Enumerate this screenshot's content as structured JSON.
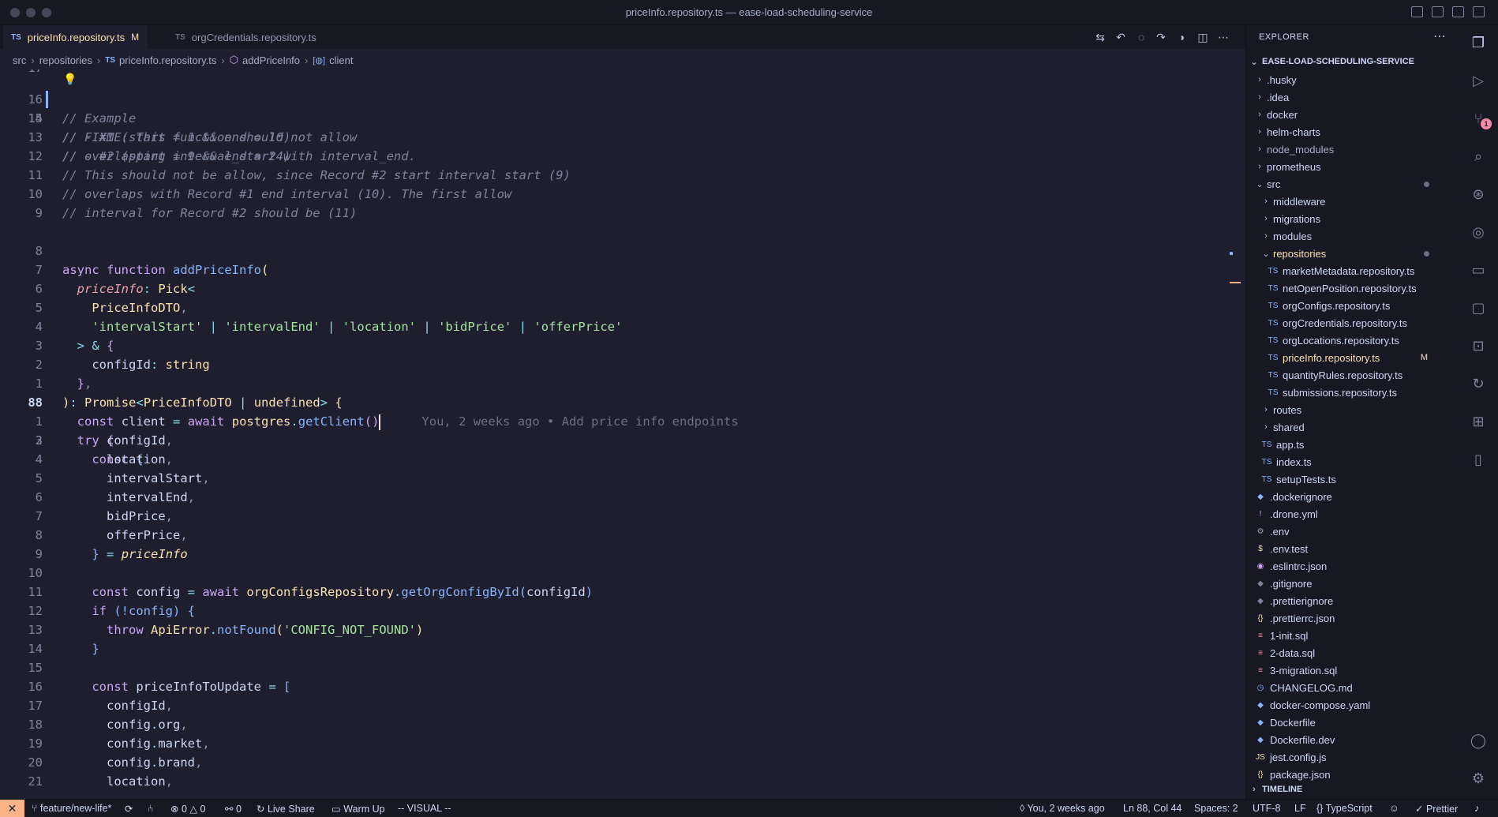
{
  "window": {
    "title": "priceInfo.repository.ts — ease-load-scheduling-service"
  },
  "tabs": [
    {
      "lang": "TS",
      "label": "priceInfo.repository.ts",
      "modified": "M"
    },
    {
      "lang": "TS",
      "label": "orgCredentials.repository.ts"
    }
  ],
  "breadcrumb": {
    "p1": "src",
    "p2": "repositories",
    "lang": "TS",
    "p3": "priceInfo.repository.ts",
    "p4": "addPriceInfo",
    "p5": "client"
  },
  "editor": {
    "top_partial_ln": "17",
    "line_numbers": [
      "16",
      "15",
      "14",
      "13",
      "12",
      "11",
      "10",
      "9",
      "8",
      "7",
      "6",
      "5",
      "4",
      "3",
      "2",
      "1",
      "88",
      "1",
      "2",
      "3",
      "4",
      "5",
      "6",
      "7",
      "8",
      "9",
      "10",
      "11",
      "12",
      "13",
      "14",
      "15",
      "16",
      "17",
      "18",
      "19",
      "20",
      "21"
    ],
    "comments": [
      "// FIXME: This function should not allow",
      "// overlapping interval_start with interval_end.",
      "// Example",
      "// - #1 (start = 1 && end = 10)",
      "// - #2 (start = 9 && end = 24)",
      "// This should not be allow, since Record #2 start interval start (9)",
      "// overlaps with Record #1 end interval (10). The first allow",
      "// interval for Record #2 should be (11)"
    ],
    "kw_async": "async",
    "kw_function": "function",
    "fn_name": "addPriceInfo",
    "paren_open": "(",
    "param": "priceInfo",
    "colon": ":",
    "pick": "Pick",
    "lt": "<",
    "dto": "PriceInfoDTO",
    "comma": ",",
    "str_intervalStart": "'intervalStart'",
    "str_intervalEnd": "'intervalEnd'",
    "str_location": "'location'",
    "str_bidPrice": "'bidPrice'",
    "str_offerPrice": "'offerPrice'",
    "pipe": "|",
    "gt": ">",
    "amp": "&",
    "brace_open": "{",
    "brace_close": "}",
    "configId": "configId",
    "string": "string",
    "promise": "Promise",
    "undefined": "undefined",
    "const": "const",
    "client": "client",
    "eq": "=",
    "await": "await",
    "postgres": "postgres",
    "dot": ".",
    "getClient": "getClient",
    "parens": "()",
    "blame": "You, 2 weeks ago • Add price info endpoints",
    "try": "try",
    "location": "location",
    "intervalStart": "intervalStart",
    "intervalEnd": "intervalEnd",
    "bidPrice": "bidPrice",
    "offerPrice": "offerPrice",
    "priceInfo": "priceInfo",
    "config": "config",
    "orgConfigsRepository": "orgConfigsRepository",
    "getOrgConfigById": "getOrgConfigById",
    "if": "if",
    "not_config": "(!config)",
    "throw": "throw",
    "ApiError": "ApiError",
    "notFound": "notFound",
    "str_config_not_found": "'CONFIG_NOT_FOUND'",
    "priceInfoToUpdate": "priceInfoToUpdate",
    "bracket_open": "[",
    "org": "org",
    "market": "market",
    "brand": "brand"
  },
  "explorer": {
    "header": "EXPLORER",
    "project": "EASE-LOAD-SCHEDULING-SERVICE",
    "items": [
      {
        "label": ".husky",
        "type": "folder",
        "depth": 1
      },
      {
        "label": ".idea",
        "type": "folder",
        "depth": 1
      },
      {
        "label": "docker",
        "type": "folder",
        "depth": 1
      },
      {
        "label": "helm-charts",
        "type": "folder",
        "depth": 1
      },
      {
        "label": "node_modules",
        "type": "folder",
        "depth": 1,
        "dim": true
      },
      {
        "label": "prometheus",
        "type": "folder",
        "depth": 1
      },
      {
        "label": "src",
        "type": "folder-open",
        "depth": 1,
        "dot": true
      },
      {
        "label": "middleware",
        "type": "folder",
        "depth": 2
      },
      {
        "label": "migrations",
        "type": "folder",
        "depth": 2
      },
      {
        "label": "modules",
        "type": "folder",
        "depth": 2
      },
      {
        "label": "repositories",
        "type": "folder-open",
        "depth": 2,
        "dot": true,
        "sel": true
      },
      {
        "label": "marketMetadata.repository.ts",
        "type": "ts",
        "depth": 3
      },
      {
        "label": "netOpenPosition.repository.ts",
        "type": "ts",
        "depth": 3
      },
      {
        "label": "orgConfigs.repository.ts",
        "type": "ts",
        "depth": 3
      },
      {
        "label": "orgCredentials.repository.ts",
        "type": "ts",
        "depth": 3
      },
      {
        "label": "orgLocations.repository.ts",
        "type": "ts",
        "depth": 3
      },
      {
        "label": "priceInfo.repository.ts",
        "type": "ts",
        "depth": 3,
        "sel": true,
        "badge": "M"
      },
      {
        "label": "quantityRules.repository.ts",
        "type": "ts",
        "depth": 3
      },
      {
        "label": "submissions.repository.ts",
        "type": "ts",
        "depth": 3
      },
      {
        "label": "routes",
        "type": "folder",
        "depth": 2
      },
      {
        "label": "shared",
        "type": "folder",
        "depth": 2
      },
      {
        "label": "app.ts",
        "type": "ts",
        "depth": 2
      },
      {
        "label": "index.ts",
        "type": "ts",
        "depth": 2
      },
      {
        "label": "setupTests.ts",
        "type": "ts",
        "depth": 2
      },
      {
        "label": ".dockerignore",
        "type": "docker",
        "depth": 1
      },
      {
        "label": ".drone.yml",
        "type": "yml",
        "depth": 1
      },
      {
        "label": ".env",
        "type": "gear",
        "depth": 1
      },
      {
        "label": ".env.test",
        "type": "dollar",
        "depth": 1
      },
      {
        "label": ".eslintrc.json",
        "type": "eslint",
        "depth": 1
      },
      {
        "label": ".gitignore",
        "type": "git",
        "depth": 1
      },
      {
        "label": ".prettierignore",
        "type": "prettier",
        "depth": 1
      },
      {
        "label": ".prettierrc.json",
        "type": "json",
        "depth": 1
      },
      {
        "label": "1-init.sql",
        "type": "sql",
        "depth": 1
      },
      {
        "label": "2-data.sql",
        "type": "sql",
        "depth": 1
      },
      {
        "label": "3-migration.sql",
        "type": "sql",
        "depth": 1
      },
      {
        "label": "CHANGELOG.md",
        "type": "clock",
        "depth": 1
      },
      {
        "label": "docker-compose.yaml",
        "type": "docker",
        "depth": 1
      },
      {
        "label": "Dockerfile",
        "type": "docker",
        "depth": 1
      },
      {
        "label": "Dockerfile.dev",
        "type": "docker",
        "depth": 1
      },
      {
        "label": "jest.config.js",
        "type": "js",
        "depth": 1
      },
      {
        "label": "package.json",
        "type": "json",
        "depth": 1
      }
    ],
    "timeline": "TIMELINE"
  },
  "activity": {
    "scm_badge": "1"
  },
  "status": {
    "branch": "feature/new-life*",
    "errors": "0",
    "warnings": "0",
    "ports": "0",
    "live_share": "Live Share",
    "warm_up": "Warm Up",
    "mode": "-- VISUAL --",
    "blame": "You, 2 weeks ago",
    "position": "Ln 88, Col 44",
    "spaces": "Spaces: 2",
    "encoding": "UTF-8",
    "eol": "LF",
    "language": "TypeScript",
    "prettier": "Prettier"
  },
  "colors": {
    "accent": "#fab387",
    "bg": "#1e1e2e",
    "sidebar": "#181825",
    "modified": "#f9e2af"
  }
}
